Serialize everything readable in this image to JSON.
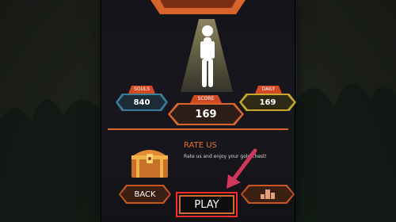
{
  "stats": {
    "souls": {
      "label": "SOULS",
      "value": "840"
    },
    "score": {
      "label": "SCORE",
      "value": "169"
    },
    "daily": {
      "label": "DAILY",
      "value": "169"
    }
  },
  "rate": {
    "title": "RATE US",
    "subtitle": "Rate us and enjoy your gold chest!"
  },
  "buttons": {
    "back": "BACK",
    "play": "PLAY"
  },
  "icons": {
    "character": "stickman-icon",
    "chest": "treasure-chest-icon",
    "leaderboard": "leaderboard-icon",
    "pointer": "arrow-pointer-icon"
  },
  "colors": {
    "accent": "#d7642a",
    "highlight": "#ff2b2b",
    "souls": "#3b7d96",
    "daily": "#c7a82c"
  }
}
